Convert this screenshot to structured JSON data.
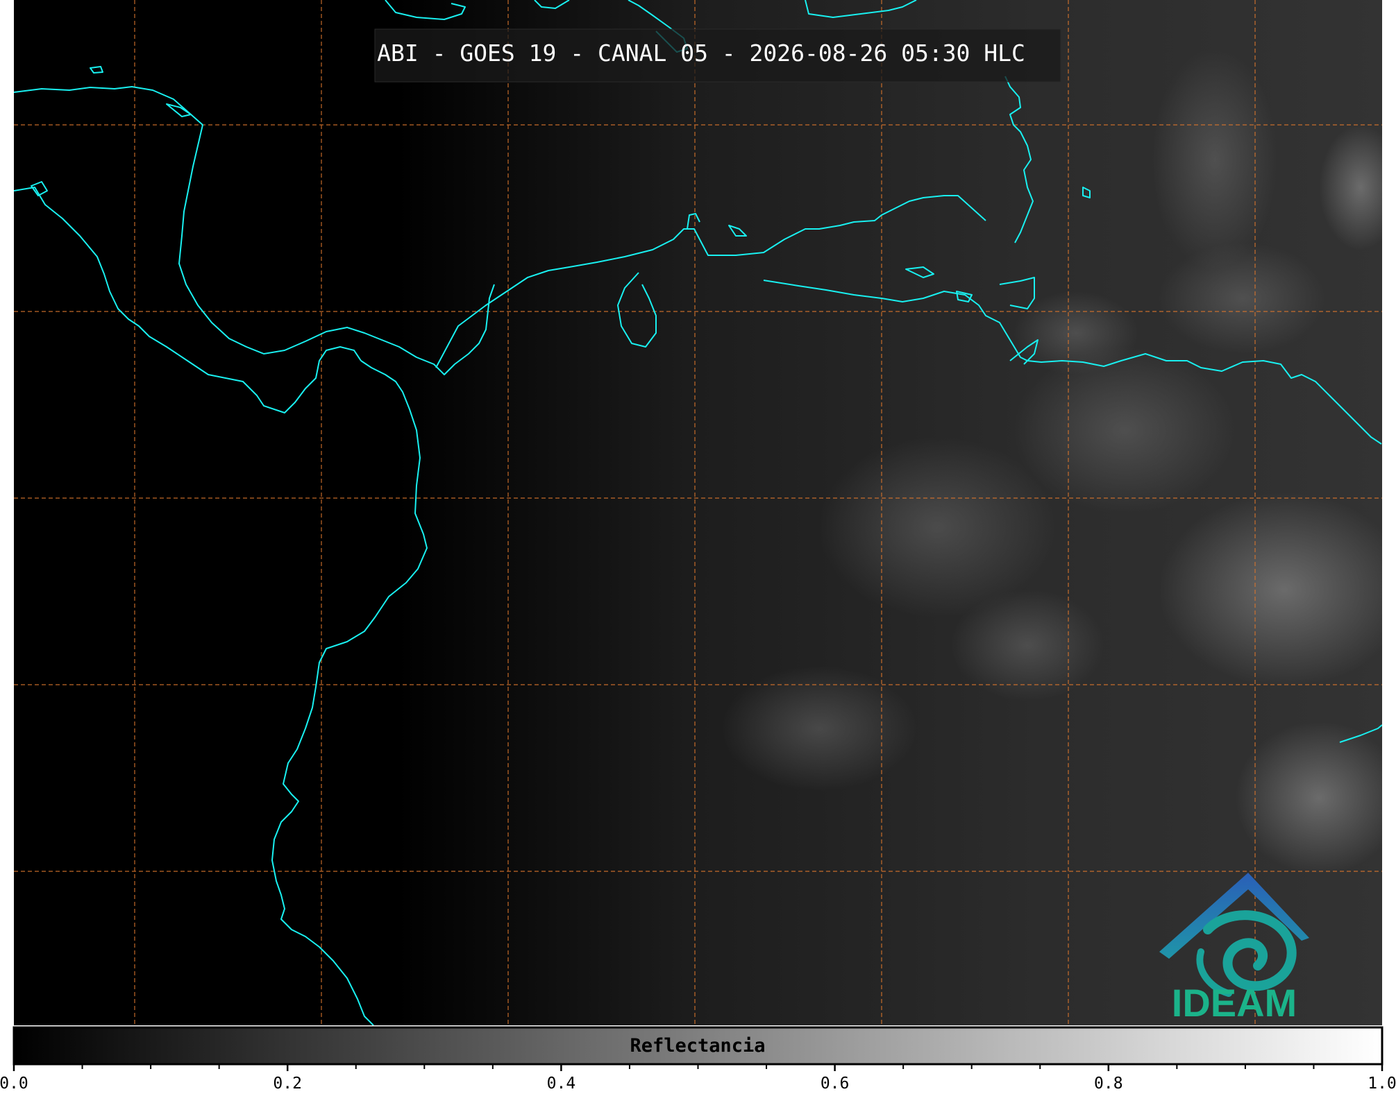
{
  "title": "ABI - GOES 19 - CANAL 05 - 2026-08-26 05:30 HLC",
  "colorbar": {
    "label": "Reflectancia",
    "ticks": [
      "0.0",
      "0.2",
      "0.4",
      "0.6",
      "0.8",
      "1.0"
    ],
    "range": [
      0.0,
      1.0
    ],
    "cmap": "grayscale"
  },
  "logo": {
    "text": "IDEAM",
    "colors": {
      "mountain": "#2d6fb0",
      "swirl": "#1aa39a",
      "text": "#1bb38a"
    }
  },
  "map": {
    "coastline_color": "#19f0f0",
    "grid_color": "#d8742c",
    "night_color": "#000000"
  }
}
